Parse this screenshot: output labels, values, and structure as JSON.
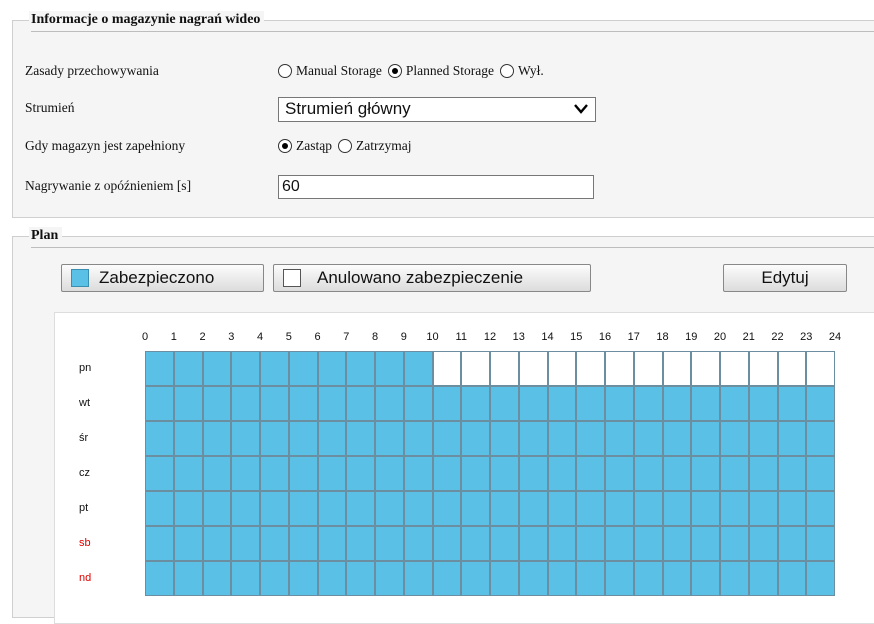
{
  "storage_info": {
    "legend": "Informacje o magazynie nagrań wideo",
    "policy": {
      "label": "Zasady przechowywania",
      "options": [
        {
          "label": "Manual Storage",
          "checked": false
        },
        {
          "label": "Planned Storage",
          "checked": true
        },
        {
          "label": "Wył.",
          "checked": false
        }
      ]
    },
    "stream": {
      "label": "Strumień",
      "value": "Strumień główny"
    },
    "when_full": {
      "label": "Gdy magazyn jest zapełniony",
      "options": [
        {
          "label": "Zastąp",
          "checked": true
        },
        {
          "label": "Zatrzymaj",
          "checked": false
        }
      ]
    },
    "delay": {
      "label": "Nagrywanie z opóźnieniem [s]",
      "value": "60"
    }
  },
  "plan": {
    "legend": "Plan",
    "buttons": {
      "armed": "Zabezpieczono",
      "disarmed": "Anulowano zabezpieczenie",
      "edit": "Edytuj"
    },
    "hours": [
      "0",
      "1",
      "2",
      "3",
      "4",
      "5",
      "6",
      "7",
      "8",
      "9",
      "10",
      "11",
      "12",
      "13",
      "14",
      "15",
      "16",
      "17",
      "18",
      "19",
      "20",
      "21",
      "22",
      "23",
      "24"
    ],
    "days": [
      {
        "label": "pn",
        "weekend": false,
        "armed_hours": 10
      },
      {
        "label": "wt",
        "weekend": false,
        "armed_hours": 24
      },
      {
        "label": "śr",
        "weekend": false,
        "armed_hours": 24
      },
      {
        "label": "cz",
        "weekend": false,
        "armed_hours": 24
      },
      {
        "label": "pt",
        "weekend": false,
        "armed_hours": 24
      },
      {
        "label": "sb",
        "weekend": true,
        "armed_hours": 24
      },
      {
        "label": "nd",
        "weekend": true,
        "armed_hours": 24
      }
    ]
  },
  "colors": {
    "armed": "#5bc0e6",
    "disarmed": "#ffffff",
    "weekend_label": "#e00000"
  }
}
